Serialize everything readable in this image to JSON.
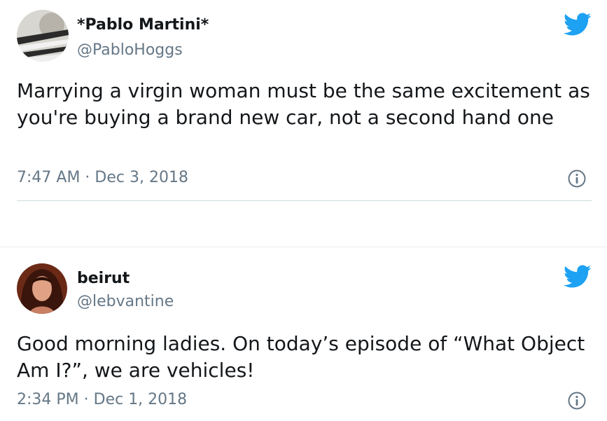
{
  "colors": {
    "twitter_blue": "#1da1f2",
    "secondary_text": "#657786",
    "primary_text": "#14171a"
  },
  "tweets": [
    {
      "display_name": "*Pablo Martini*",
      "handle": "@PabloHoggs",
      "text": "Marrying a virgin woman must be the same excitement as you're buying a brand new car, not a second hand one",
      "timestamp": "7:47 AM · Dec 3, 2018",
      "icons": [
        "twitter-bird-icon",
        "info-icon"
      ]
    },
    {
      "display_name": "beirut",
      "handle": "@lebvantine",
      "text": "Good morning ladies. On today’s episode of “What Object Am I?”, we are vehicles!",
      "timestamp": "2:34 PM · Dec 1, 2018",
      "icons": [
        "twitter-bird-icon",
        "info-icon"
      ]
    }
  ]
}
